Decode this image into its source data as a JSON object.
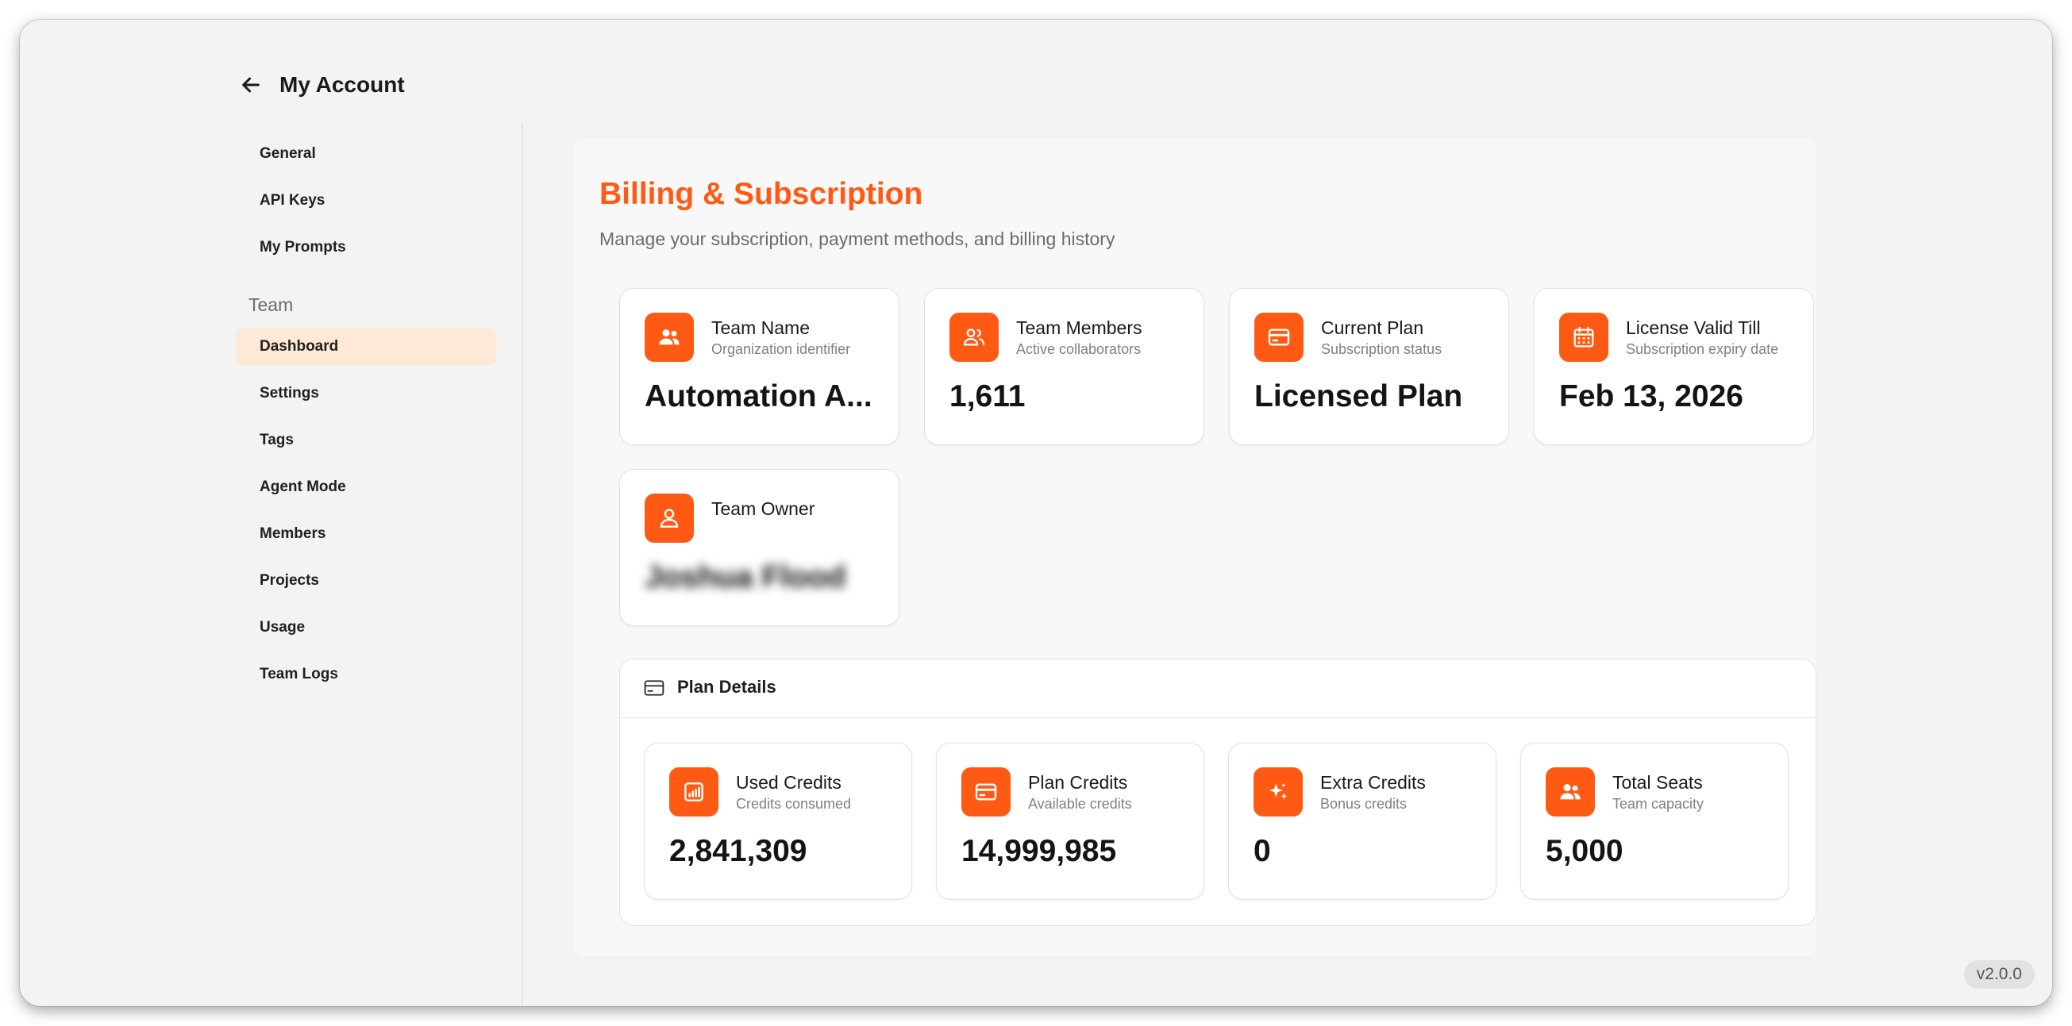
{
  "header": {
    "title": "My Account"
  },
  "sidebar": {
    "items": [
      {
        "label": "General"
      },
      {
        "label": "API Keys"
      },
      {
        "label": "My Prompts"
      }
    ],
    "team_section": "Team",
    "team_items": [
      {
        "label": "Dashboard",
        "active": true
      },
      {
        "label": "Settings"
      },
      {
        "label": "Tags"
      },
      {
        "label": "Agent Mode"
      },
      {
        "label": "Members"
      },
      {
        "label": "Projects"
      },
      {
        "label": "Usage"
      },
      {
        "label": "Team Logs"
      }
    ]
  },
  "main": {
    "title": "Billing & Subscription",
    "subtitle": "Manage your subscription, payment methods, and billing history",
    "cards": [
      {
        "icon": "users-icon",
        "title": "Team Name",
        "subtitle": "Organization identifier",
        "value": "Automation A..."
      },
      {
        "icon": "team-members-icon",
        "title": "Team Members",
        "subtitle": "Active collaborators",
        "value": "1,611"
      },
      {
        "icon": "credit-card-icon",
        "title": "Current Plan",
        "subtitle": "Subscription status",
        "value": "Licensed Plan"
      },
      {
        "icon": "calendar-icon",
        "title": "License Valid Till",
        "subtitle": "Subscription expiry date",
        "value": "Feb 13, 2026"
      },
      {
        "icon": "user-icon",
        "title": "Team Owner",
        "subtitle": "",
        "value": "Joshua Flood"
      }
    ],
    "plan_details": {
      "title": "Plan Details",
      "cards": [
        {
          "icon": "chart-icon",
          "title": "Used Credits",
          "subtitle": "Credits consumed",
          "value": "2,841,309"
        },
        {
          "icon": "credit-card-icon",
          "title": "Plan Credits",
          "subtitle": "Available credits",
          "value": "14,999,985"
        },
        {
          "icon": "sparkle-icon",
          "title": "Extra Credits",
          "subtitle": "Bonus credits",
          "value": "0"
        },
        {
          "icon": "users-icon",
          "title": "Total Seats",
          "subtitle": "Team capacity",
          "value": "5,000"
        }
      ]
    }
  },
  "version": "v2.0.0",
  "colors": {
    "accent": "#ff5a14",
    "active_nav_bg": "#fde9d6"
  }
}
